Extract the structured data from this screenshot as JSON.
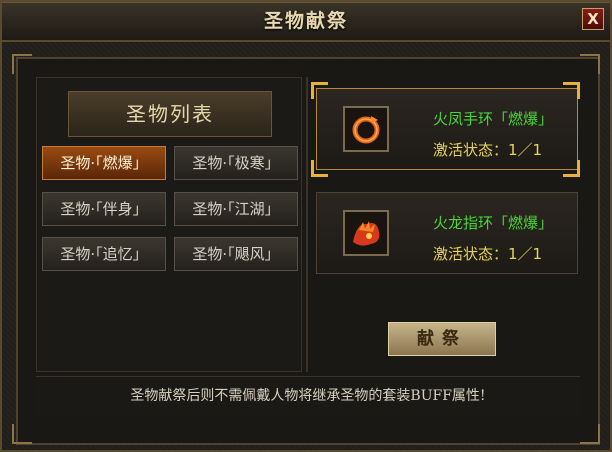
{
  "window": {
    "title": "圣物献祭",
    "close_label": "X"
  },
  "list": {
    "header": "圣物列表",
    "items": [
      {
        "label": "圣物·「燃爆」",
        "active": true
      },
      {
        "label": "圣物·「极寒」",
        "active": false
      },
      {
        "label": "圣物·「伴身」",
        "active": false
      },
      {
        "label": "圣物·「江湖」",
        "active": false
      },
      {
        "label": "圣物·「追忆」",
        "active": false
      },
      {
        "label": "圣物·「飓风」",
        "active": false
      }
    ]
  },
  "relics": [
    {
      "name": "火凤手环「燃爆」",
      "status": "激活状态：1／1",
      "icon": "phoenix-bracelet-icon"
    },
    {
      "name": "火龙指环「燃爆」",
      "status": "激活状态：1／1",
      "icon": "dragon-ring-icon"
    }
  ],
  "dedicate_label": "献祭",
  "footer_text": "圣物献祭后则不需佩戴人物将继承圣物的套装BUFF属性!",
  "colors": {
    "relic_name": "#4cd43a",
    "relic_status": "#e6d45c",
    "active_item": "#9a4b12"
  }
}
